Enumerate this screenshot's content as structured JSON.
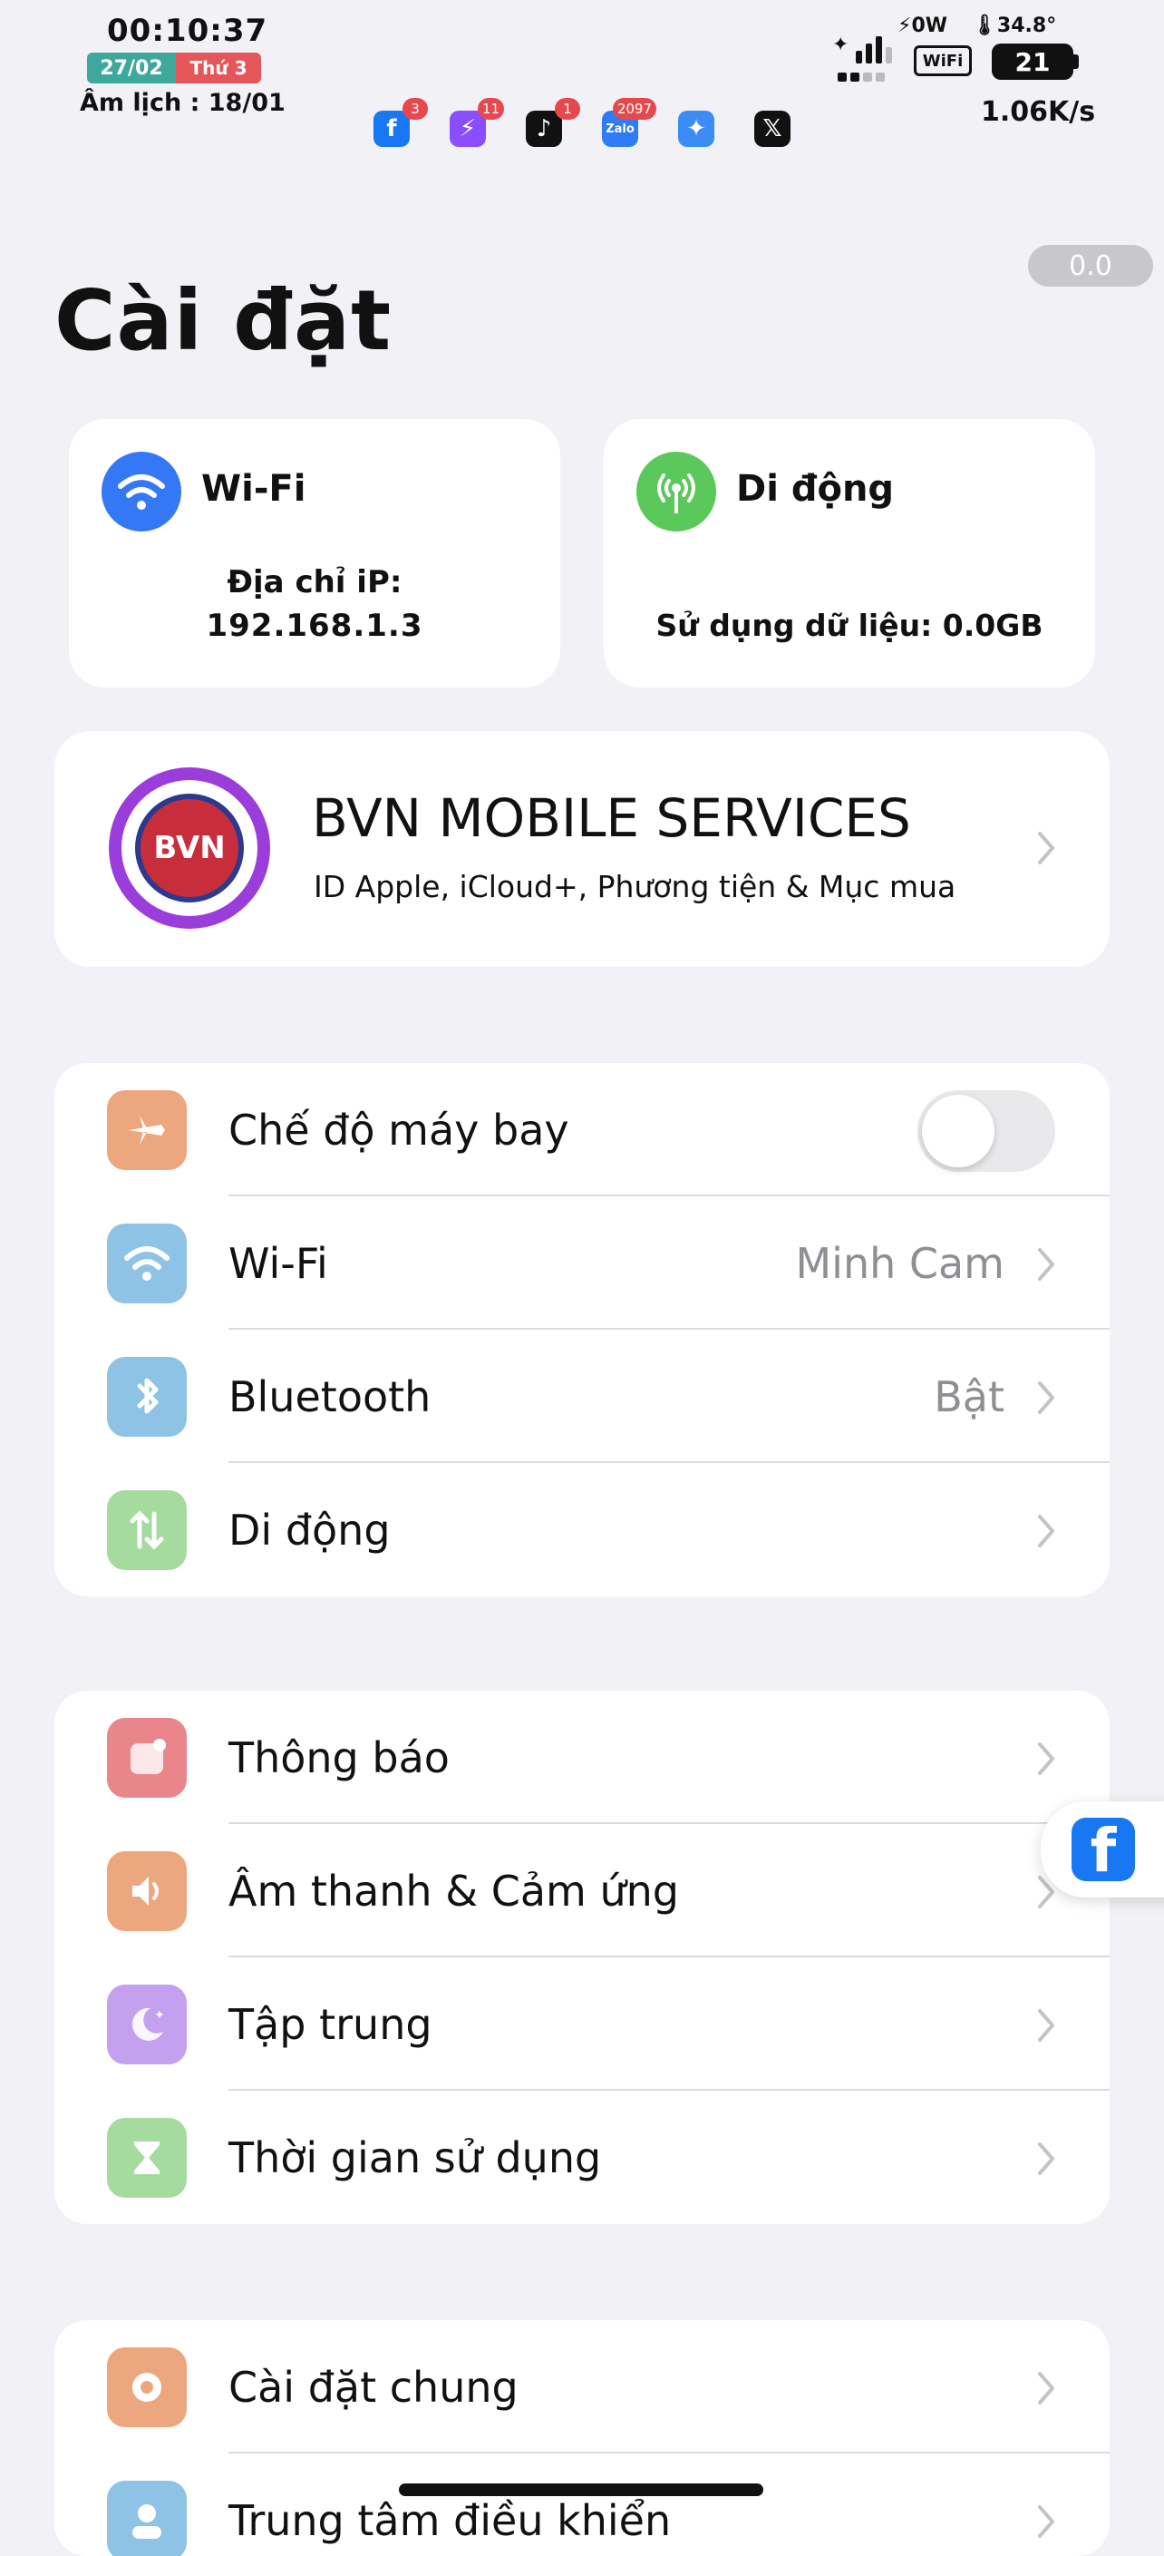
{
  "status": {
    "time": "00:10:37",
    "date": "27/02",
    "weekday": "Thứ 3",
    "lunar": "Âm lịch : 18/01",
    "power": "⚡0W",
    "temperature": "🌡34.8°",
    "wifi_label": "WiFi",
    "battery": "21",
    "speed": "1.06K/s",
    "notifications": [
      {
        "app": "facebook-icon",
        "badge": "3",
        "glyph": "f",
        "color": "#1877f2"
      },
      {
        "app": "messenger-icon",
        "badge": "11",
        "glyph": "⚡",
        "color": "#8a4dff"
      },
      {
        "app": "tiktok-icon",
        "badge": "1",
        "glyph": "♪",
        "color": "#111111"
      },
      {
        "app": "zalo-icon",
        "badge": "2097",
        "glyph": "Zalo",
        "color": "#2f7cf6"
      },
      {
        "app": "safari-icon",
        "badge": "",
        "glyph": "✦",
        "color": "#3b8df5"
      },
      {
        "app": "x-icon",
        "badge": "",
        "glyph": "𝕏",
        "color": "#111111"
      }
    ]
  },
  "version": "0.0",
  "title": "Cài đặt",
  "wifi_card": {
    "title": "Wi-Fi",
    "ip_label": "Địa chỉ iP:",
    "ip": "192.168.1.3"
  },
  "cell_card": {
    "title": "Di động",
    "usage": "Sử dụng dữ liệu: 0.0GB"
  },
  "profile": {
    "name": "BVN MOBILE SERVICES",
    "subtitle": "ID Apple, iCloud+, Phương tiện & Mục mua",
    "logo_text": "BVN"
  },
  "group1": [
    {
      "label": "Chế độ máy bay",
      "value": "",
      "icon": "airplane-icon",
      "color": "#eca77e",
      "toggle": true
    },
    {
      "label": "Wi-Fi",
      "value": "Minh Cam",
      "icon": "wifi-icon",
      "color": "#8fc3e6"
    },
    {
      "label": "Bluetooth",
      "value": "Bật",
      "icon": "bluetooth-icon",
      "color": "#8fc3e6"
    },
    {
      "label": "Di động",
      "value": "",
      "icon": "cellular-icon",
      "color": "#a6dba0"
    }
  ],
  "group2": [
    {
      "label": "Thông báo",
      "icon": "notification-icon",
      "color": "#e8868c"
    },
    {
      "label": "Âm thanh & Cảm ứng",
      "icon": "sound-icon",
      "color": "#eca77e"
    },
    {
      "label": "Tập trung",
      "icon": "moon-icon",
      "color": "#c3a1ef"
    },
    {
      "label": "Thời gian sử dụng",
      "icon": "hourglass-icon",
      "color": "#a6dba0"
    }
  ],
  "group3": [
    {
      "label": "Cài đặt chung",
      "icon": "gear-icon",
      "color": "#eca77e"
    },
    {
      "label": "Trung tâm điều khiển",
      "icon": "control-center-icon",
      "color": "#8fc3e6"
    }
  ]
}
